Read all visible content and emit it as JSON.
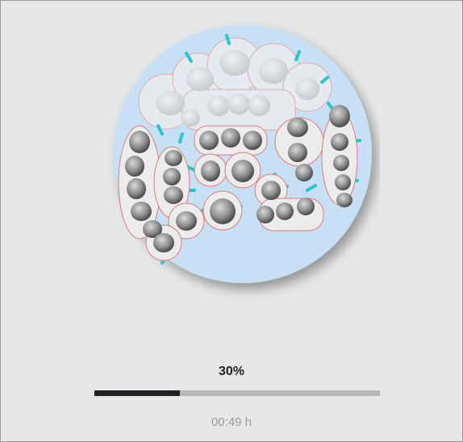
{
  "progress": {
    "percent_label": "30%",
    "fraction": 0.3,
    "time_label": "00:49 h"
  },
  "colors": {
    "background": "#e6e7e7",
    "disc": "#c7e0f5",
    "tooth_halo": "#ededed",
    "tooth": "#888888",
    "connector": "#29c5cd",
    "outline": "#d9534f",
    "progress_track": "#b7b8b8",
    "progress_fill": "#202122"
  },
  "preview": {
    "icon": "milling-disc-icon"
  }
}
